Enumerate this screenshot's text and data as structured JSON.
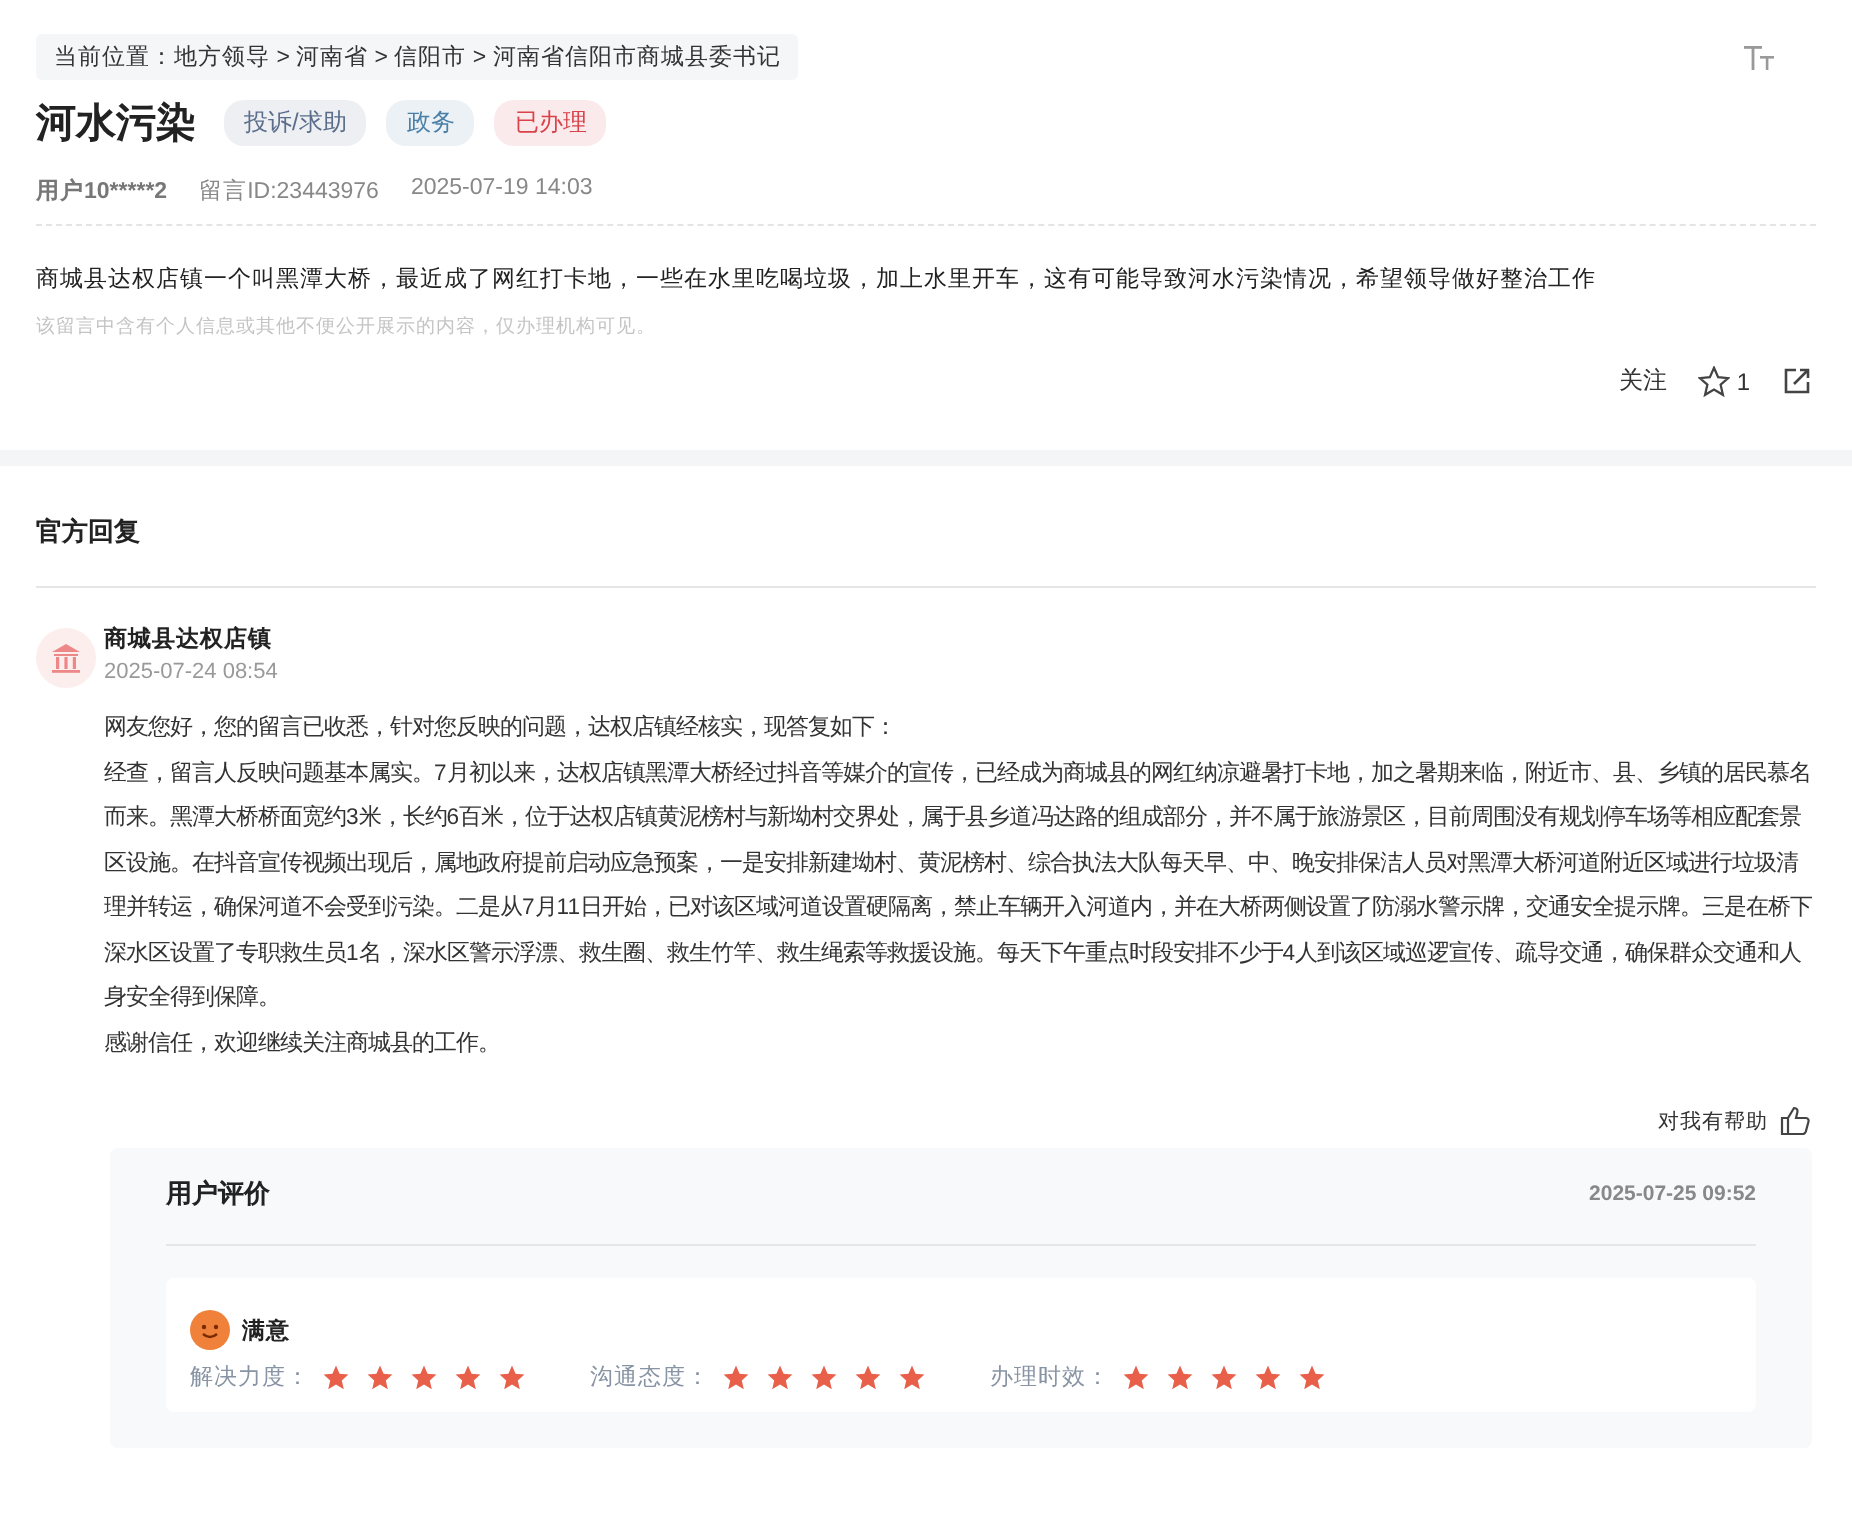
{
  "breadcrumb": "当前位置：地方领导 > 河南省 > 信阳市 > 河南省信阳市商城县委书记",
  "title": "河水污染",
  "tags": [
    {
      "label": "投诉/求助",
      "color": "#5a6e8c"
    },
    {
      "label": "政务",
      "color": "#4a7fa8"
    },
    {
      "label": "已办理",
      "color": "#d9434b"
    }
  ],
  "meta": {
    "user": "用户10*****2",
    "message_id": "留言ID:23443976",
    "time": "2025-07-19 14:03"
  },
  "content": "商城县达权店镇一个叫黑潭大桥，最近成了网红打卡地，一些在水里吃喝垃圾，加上水里开车，这有可能导致河水污染情况，希望领导做好整治工作",
  "notice": "该留言中含有个人信息或其他不便公开展示的内容，仅办理机构可见。",
  "actions": {
    "follow": "关注",
    "favorites": "1"
  },
  "official_reply": {
    "heading": "官方回复",
    "org": "商城县达权店镇",
    "time": "2025-07-24 08:54",
    "paragraphs": [
      "网友您好，您的留言已收悉，针对您反映的问题，达权店镇经核实，现答复如下：",
      "经查，留言人反映问题基本属实。7月初以来，达权店镇黑潭大桥经过抖音等媒介的宣传，已经成为商城县的网红纳凉避暑打卡地，加之暑期来临，附近市、县、乡镇的居民慕名而来。黑潭大桥桥面宽约3米，长约6百米，位于达权店镇黄泥榜村与新坳村交界处，属于县乡道冯达路的组成部分，并不属于旅游景区，目前周围没有规划停车场等相应配套景区设施。在抖音宣传视频出现后，属地政府提前启动应急预案，一是安排新建坳村、黄泥榜村、综合执法大队每天早、中、晚安排保洁人员对黑潭大桥河道附近区域进行垃圾清理并转运，确保河道不会受到污染。二是从7月11日开始，已对该区域河道设置硬隔离，禁止车辆开入河道内，并在大桥两侧设置了防溺水警示牌，交通安全提示牌。三是在桥下深水区设置了专职救生员1名，深水区警示浮漂、救生圈、救生竹竿、救生绳索等救援设施。每天下午重点时段安排不少于4人到该区域巡逻宣传、疏导交通，确保群众交通和人身安全得到保障。",
      "感谢信任，欢迎继续关注商城县的工作。"
    ],
    "helpful": "对我有帮助"
  },
  "evaluation": {
    "heading": "用户评价",
    "time": "2025-07-25 09:52",
    "verdict": "满意",
    "ratings": [
      {
        "label": "解决力度：",
        "stars": 5
      },
      {
        "label": "沟通态度：",
        "stars": 5
      },
      {
        "label": "办理时效：",
        "stars": 5
      }
    ]
  }
}
